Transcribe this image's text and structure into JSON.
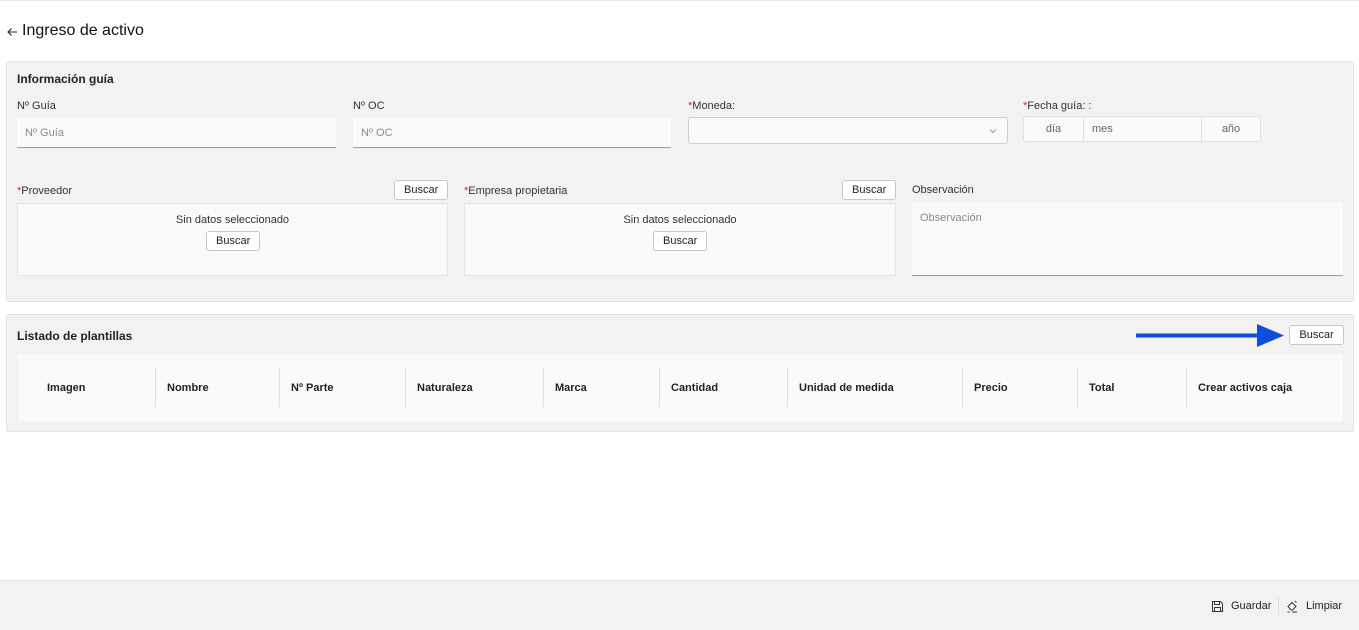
{
  "header": {
    "title": "Ingreso de activo",
    "back_icon": "arrow-left-icon"
  },
  "info_panel": {
    "title": "Información guía",
    "guia": {
      "label": "Nº Guía",
      "placeholder": "Nº Guía",
      "value": ""
    },
    "oc": {
      "label": "Nº OC",
      "placeholder": "Nº OC",
      "value": ""
    },
    "moneda": {
      "required_mark": "*",
      "label": "Moneda:",
      "value": ""
    },
    "fecha": {
      "required_mark": "*",
      "label": "Fecha guía: :",
      "dia": "día",
      "mes": "mes",
      "ano": "año"
    },
    "proveedor": {
      "required_mark": "*",
      "label": "Proveedor",
      "search_label": "Buscar",
      "empty_text": "Sin datos seleccionado",
      "inner_search_label": "Buscar"
    },
    "empresa": {
      "required_mark": "*",
      "label": "Empresa propietaria",
      "search_label": "Buscar",
      "empty_text": "Sin datos seleccionado",
      "inner_search_label": "Buscar"
    },
    "observacion": {
      "label": "Observación",
      "placeholder": "Observación",
      "value": ""
    }
  },
  "list_panel": {
    "title": "Listado de plantillas",
    "search_label": "Buscar",
    "columns": [
      "Imagen",
      "Nombre",
      "Nº Parte",
      "Naturaleza",
      "Marca",
      "Cantidad",
      "Unidad de medida",
      "Precio",
      "Total",
      "Crear activos caja"
    ]
  },
  "annotation": {
    "arrow_color": "#0b4fdc"
  },
  "footer": {
    "save_label": "Guardar",
    "save_icon": "save-icon",
    "clear_label": "Limpiar",
    "clear_icon": "eraser-icon"
  }
}
